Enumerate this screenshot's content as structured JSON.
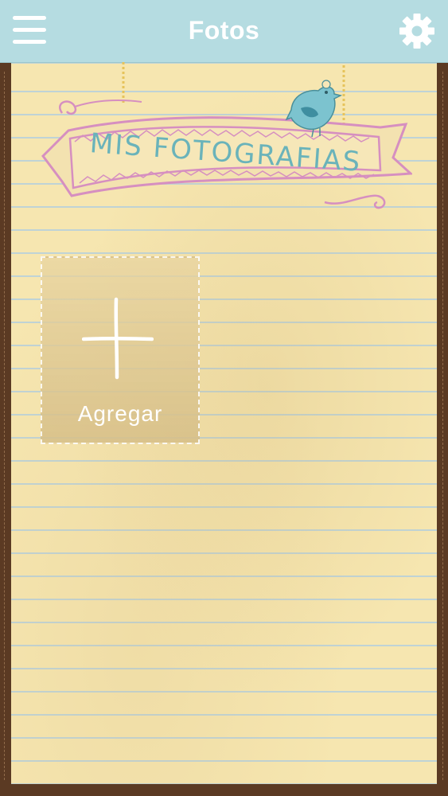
{
  "topbar": {
    "title": "Fotos",
    "menu_icon": "hamburger-menu-icon",
    "settings_icon": "gear-icon"
  },
  "banner": {
    "text": "MIS FOTOGRAFIAS"
  },
  "add_tile": {
    "label": "Agregar",
    "icon": "plus-icon"
  },
  "colors": {
    "topbar": "#b5dce1",
    "paper": "#f6e6b0",
    "frame": "#5b3a23",
    "banner_pink": "#d68fc0",
    "banner_text": "#6ab3ba"
  }
}
